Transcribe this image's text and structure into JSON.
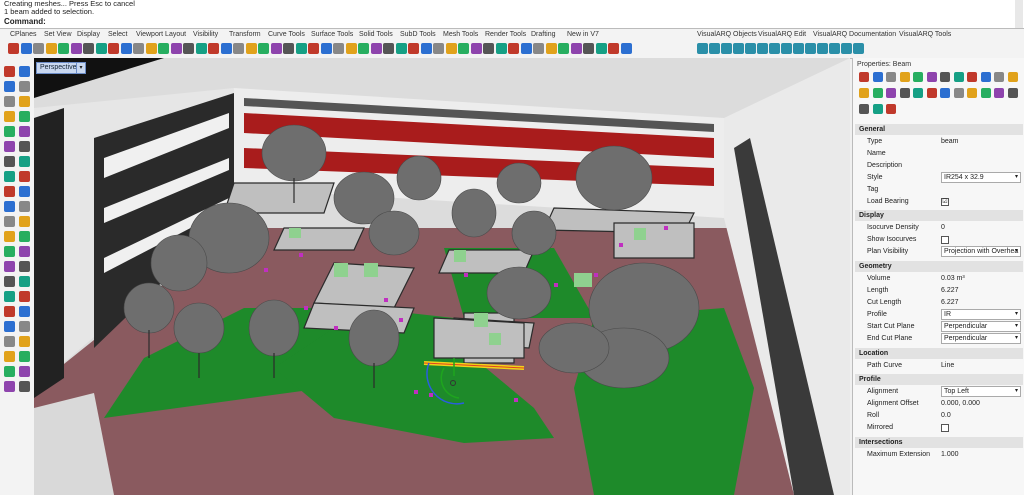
{
  "command_history": [
    "Creating meshes... Press Esc to cancel",
    "1 beam added to selection."
  ],
  "command_label": "Command:",
  "menu_tabs": [
    "CPlanes",
    "Set View",
    "Display",
    "Select",
    "Viewport Layout",
    "Visibility",
    "Transform",
    "Curve Tools",
    "Surface Tools",
    "Solid Tools",
    "SubD Tools",
    "Mesh Tools",
    "Render Tools",
    "Drafting",
    "New in V7",
    "VisualARQ Objects",
    "VisualARQ Edit",
    "VisualARQ Documentation",
    "VisualARQ Tools"
  ],
  "viewport": {
    "name": "Perspective",
    "arrow_icon": "chevron-down-icon"
  },
  "properties": {
    "title": "Properties: Beam",
    "sections": {
      "general": "General",
      "display": "Display",
      "geometry": "Geometry",
      "location": "Location",
      "profile": "Profile",
      "intersections": "Intersections"
    },
    "general": {
      "type_k": "Type",
      "type_v": "beam",
      "name_k": "Name",
      "name_v": "",
      "desc_k": "Description",
      "desc_v": "",
      "style_k": "Style",
      "style_v": "IR254 x 32.9",
      "tag_k": "Tag",
      "tag_v": "",
      "load_k": "Load Bearing",
      "load_v": "☑"
    },
    "display": {
      "iso_k": "Isocurve Density",
      "iso_v": "0",
      "showiso_k": "Show Isocurves",
      "showiso_v": "",
      "plan_k": "Plan Visibility",
      "plan_v": "Projection with Overhea"
    },
    "geometry": {
      "vol_k": "Volume",
      "vol_v": "0.03 m³",
      "len_k": "Length",
      "len_v": "6.227",
      "cut_k": "Cut Length",
      "cut_v": "6.227",
      "prof_k": "Profile",
      "prof_v": "IR",
      "scp_k": "Start Cut Plane",
      "scp_v": "Perpendicular",
      "ecp_k": "End Cut Plane",
      "ecp_v": "Perpendicular"
    },
    "location": {
      "path_k": "Path Curve",
      "path_v": "Line"
    },
    "profile": {
      "align_k": "Alignment",
      "align_v": "Top Left",
      "offset_k": "Alignment Offset",
      "offset_v": "0.000, 0.000",
      "roll_k": "Roll",
      "roll_v": "0.0",
      "mir_k": "Mirrored",
      "mir_v": ""
    },
    "intersections": {
      "maxext_k": "Maximum Extension",
      "maxext_v": "1.000"
    }
  }
}
